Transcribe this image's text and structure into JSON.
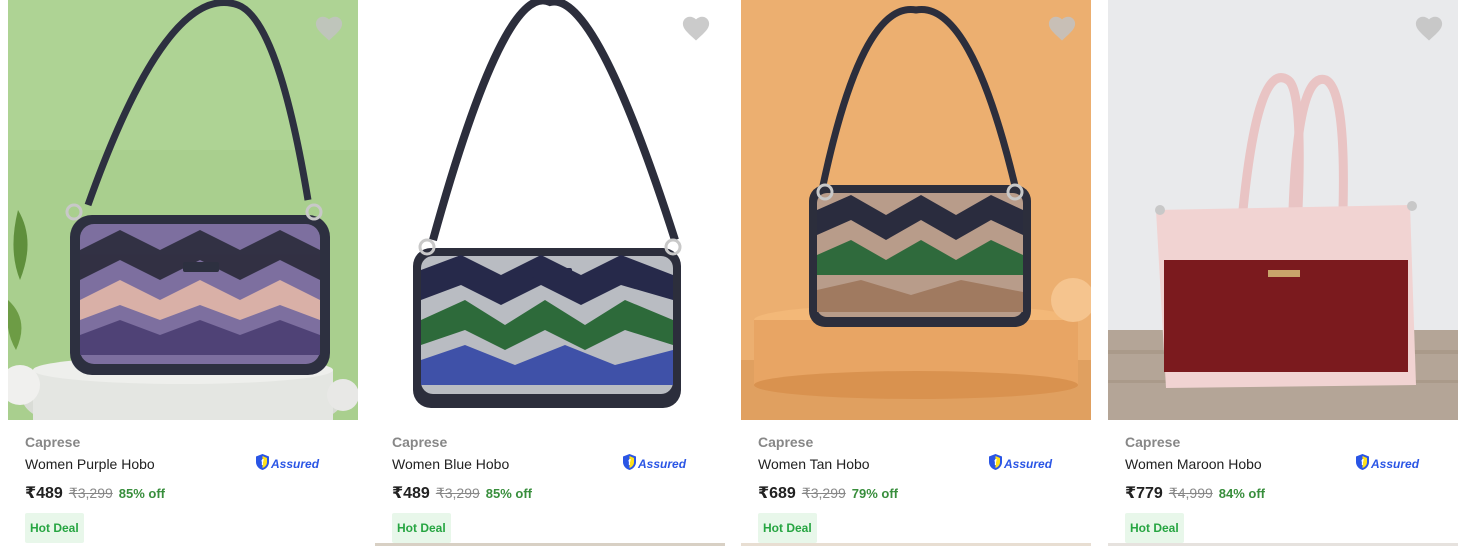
{
  "products": [
    {
      "brand": "Caprese",
      "title": "Women Purple Hobo",
      "assured": "Assured",
      "price": "₹489",
      "mrp": "₹3,299",
      "discount": "85% off",
      "badge": "Hot Deal",
      "bg": "#a9cf8e",
      "product_image": "purple-hobo-bag"
    },
    {
      "brand": "Caprese",
      "title": "Women Blue Hobo",
      "assured": "Assured",
      "price": "₹489",
      "mrp": "₹3,299",
      "discount": "85% off",
      "badge": "Hot Deal",
      "bg": "#ffffff",
      "product_image": "blue-hobo-bag"
    },
    {
      "brand": "Caprese",
      "title": "Women Tan Hobo",
      "assured": "Assured",
      "price": "₹689",
      "mrp": "₹3,299",
      "discount": "79% off",
      "badge": "Hot Deal",
      "bg": "#e9a969",
      "product_image": "tan-hobo-bag"
    },
    {
      "brand": "Caprese",
      "title": "Women Maroon Hobo",
      "assured": "Assured",
      "price": "₹779",
      "mrp": "₹4,999",
      "discount": "84% off",
      "badge": "Hot Deal",
      "bg": "#e2e3e5",
      "product_image": "maroon-tote-bag"
    }
  ],
  "icons": {
    "wishlist": "heart-icon",
    "assured": "shield-icon"
  },
  "colors": {
    "assured_blue": "#2a55e5",
    "discount_green": "#388e3c",
    "badge_bg": "#e8f7ea",
    "badge_text": "#26a541"
  }
}
